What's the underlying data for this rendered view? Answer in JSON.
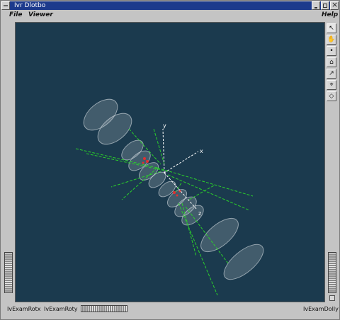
{
  "window": {
    "title": "Ivr Dlotbo"
  },
  "menubar": {
    "file": "File",
    "viewer": "Viewer",
    "help": "Help"
  },
  "statusbar": {
    "rotx": "IvExamRotx",
    "roty": "IvExamRoty",
    "dolly": "IvExamDolly"
  },
  "scene": {
    "axis_x": "x",
    "axis_y": "y",
    "axis_z": "z",
    "colors": {
      "background": "#1b3a4e",
      "tracks": "#2bd02b",
      "hits": "#e03030",
      "detector": "#cfd8dc",
      "axes": "#ffffff"
    }
  },
  "toolbar": {
    "tools": [
      "pick-arrow",
      "view-hand",
      "home",
      "set-home",
      "view-all",
      "seek",
      "perspective"
    ]
  }
}
